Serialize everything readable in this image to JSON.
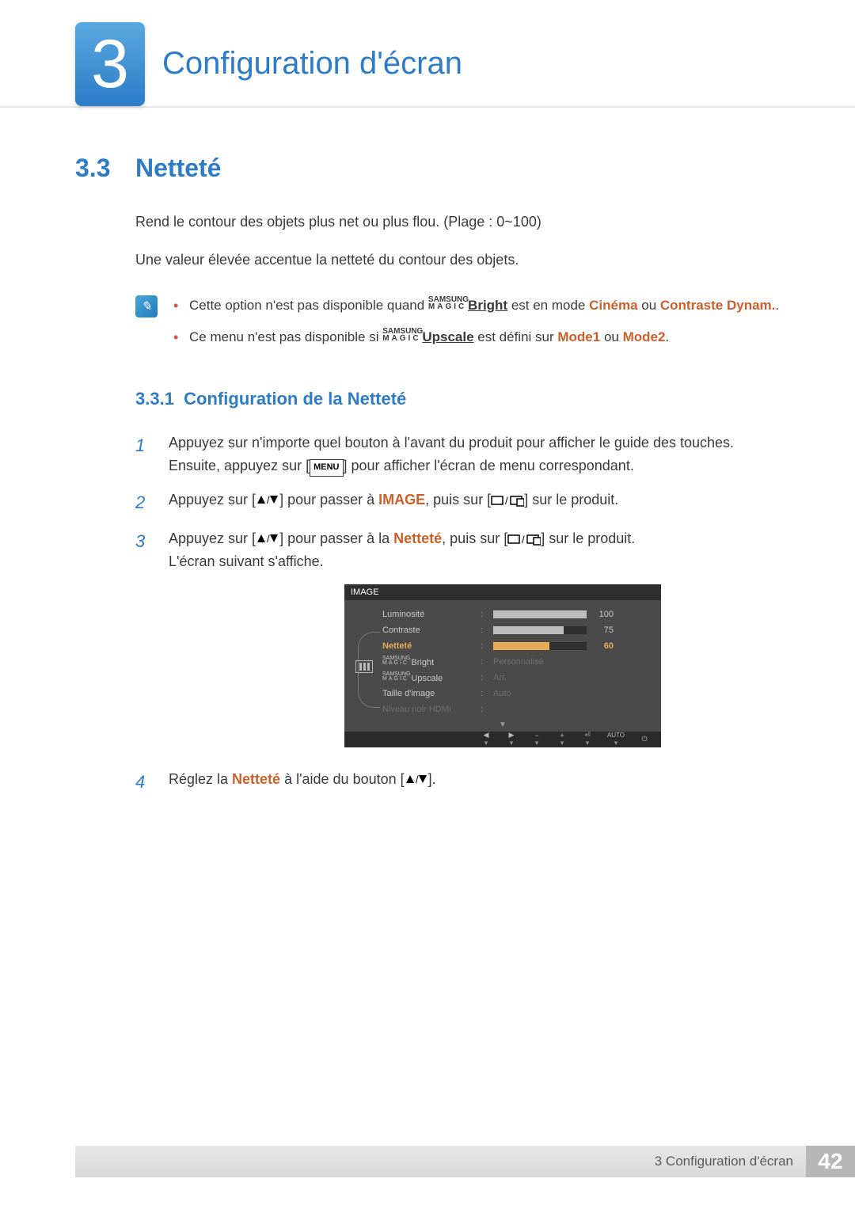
{
  "chapter": {
    "number": "3",
    "title": "Configuration d'écran"
  },
  "section": {
    "number": "3.3",
    "title": "Netteté"
  },
  "intro": {
    "p1": "Rend le contour des objets plus net ou plus flou. (Plage : 0~100)",
    "p2": "Une valeur élevée accentue la netteté du contour des objets."
  },
  "magic": {
    "top": "SAMSUNG",
    "bot": "MAGIC"
  },
  "notes": {
    "b1_a": "Cette option n'est pas disponible quand ",
    "b1_bright": "Bright",
    "b1_b": " est en mode ",
    "b1_cinema": "Cinéma",
    "b1_c": " ou ",
    "b1_contrast": "Contraste Dynam.",
    "b1_d": ".",
    "b2_a": "Ce menu n'est pas disponible si ",
    "b2_upscale": "Upscale",
    "b2_b": " est défini sur ",
    "b2_mode1": "Mode1",
    "b2_c": " ou ",
    "b2_mode2": "Mode2",
    "b2_d": "."
  },
  "subsection": {
    "number": "3.3.1",
    "title": "Configuration de la Netteté"
  },
  "steps": {
    "s1_a": "Appuyez sur n'importe quel bouton à l'avant du produit pour afficher le guide des touches. Ensuite, appuyez sur [",
    "s1_menu": "MENU",
    "s1_b": "] pour afficher l'écran de menu correspondant.",
    "s2_a": "Appuyez sur [",
    "s2_b": "] pour passer à ",
    "s2_image": "IMAGE",
    "s2_c": ", puis sur [",
    "s2_d": "] sur le produit.",
    "s3_a": "Appuyez sur [",
    "s3_b": "] pour passer à la ",
    "s3_net": "Netteté",
    "s3_c": ", puis sur [",
    "s3_d": "] sur le produit.",
    "s3_e": "L'écran suivant s'affiche.",
    "s4_a": "Réglez la ",
    "s4_net": "Netteté",
    "s4_b": " à l'aide du bouton [",
    "s4_c": "]."
  },
  "osd": {
    "title": "IMAGE",
    "rows": [
      {
        "label": "Luminosité",
        "value": "100",
        "fill": 100,
        "type": "bar"
      },
      {
        "label": "Contraste",
        "value": "75",
        "fill": 75,
        "type": "bar"
      },
      {
        "label": "Netteté",
        "value": "60",
        "fill": 60,
        "type": "bar",
        "selected": true
      },
      {
        "label": "Bright",
        "magic": true,
        "text": "Personnalisé",
        "type": "text",
        "dim": true
      },
      {
        "label": "Upscale",
        "magic": true,
        "text": "Arr.",
        "type": "text",
        "dim": true
      },
      {
        "label": "Taille d'image",
        "text": "Auto",
        "type": "text",
        "dim": true
      },
      {
        "label": "Niveau noir HDMI",
        "text": "",
        "type": "text",
        "dim": true,
        "labeldim": true
      }
    ],
    "footer_auto": "AUTO"
  },
  "footer": {
    "text": "3 Configuration d'écran",
    "page": "42"
  }
}
